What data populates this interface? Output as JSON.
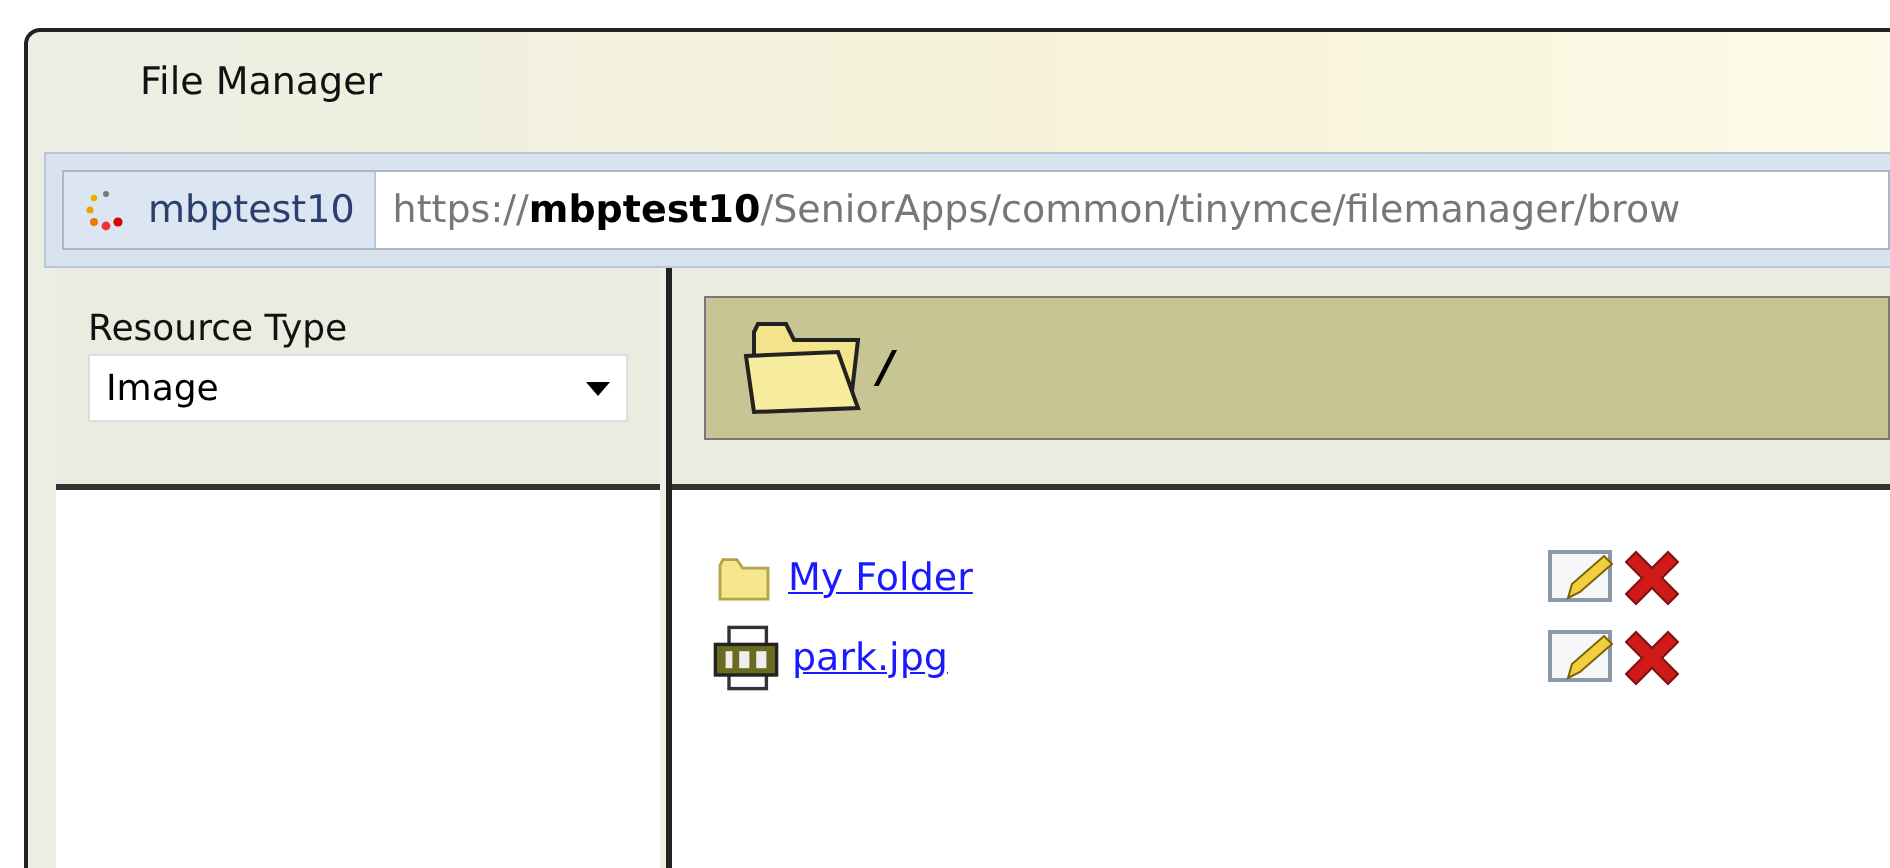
{
  "window": {
    "title": "File Manager"
  },
  "address_bar": {
    "site": "mbptest10",
    "url": "https://**mbptest10**/SeniorApps/common/tinymce/filemanager/brow"
  },
  "resource_type": {
    "label": "Resource Type",
    "value": "Image"
  },
  "path": {
    "text": "/"
  },
  "files": [
    {
      "kind": "folder",
      "name": "My Folder"
    },
    {
      "kind": "image",
      "name": "park.jpg"
    }
  ]
}
